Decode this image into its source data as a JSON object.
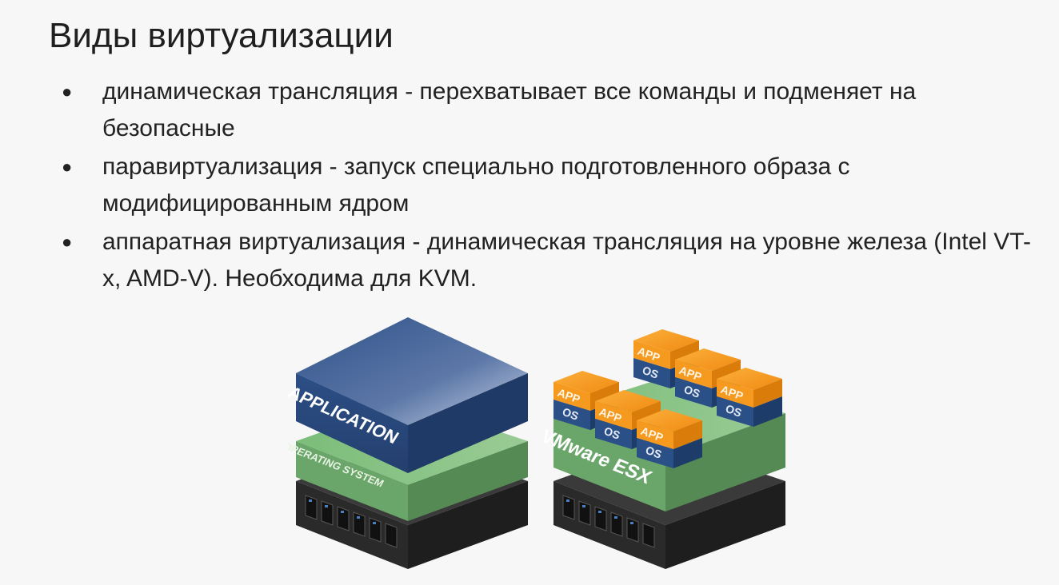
{
  "slide": {
    "title": "Виды виртуализации",
    "bullets": [
      {
        "text": "динамическая трансляция - перехватывает все команды и подменяет на безопасные"
      },
      {
        "text": "паравиртуализация - запуск специально подготовленного образа с модифицированным ядром"
      },
      {
        "text": "аппаратная виртуализация - динамическая трансляция на уровне железа (Intel VT-x, AMD-V). Необходима для KVM."
      }
    ]
  },
  "figure": {
    "left_stack": {
      "app_label": "APPLICATION",
      "os_label": "OPERATING SYSTEM"
    },
    "right_stack": {
      "hypervisor_label": "VMware ESX",
      "vm_app_label": "APP",
      "vm_os_label": "OS"
    },
    "colors": {
      "app_blue": "#2f5189",
      "os_green": "#6aa56a",
      "server_dark": "#2a2a2a",
      "vm_orange": "#f59a1f",
      "vm_os_blue": "#2b4f87"
    }
  }
}
